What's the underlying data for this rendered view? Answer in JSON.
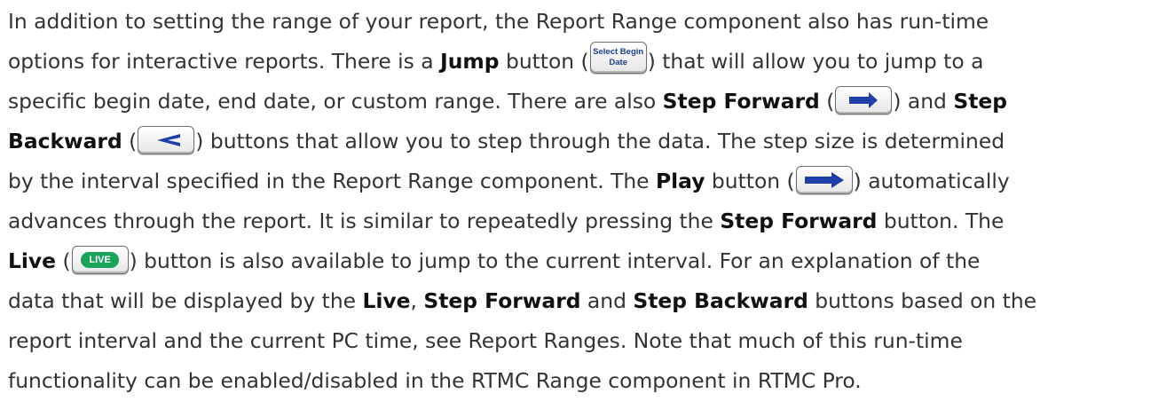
{
  "text": {
    "l1": "In addition to setting the range of your report, the Report Range component also has run-time",
    "l2a": "options for interactive reports. There is a ",
    "jump_term": "Jump",
    "l2b": " button (",
    "l2c": ") that will allow you to jump to a",
    "l3a": "specific begin date, end date, or custom range. There are also ",
    "step_forward_term": "Step Forward",
    "l3b": " (",
    "l3c": ") and ",
    "step_term": "Step",
    "backward_term": "Backward",
    "l4a": " (",
    "l4b": ") buttons that allow you to step through the data. The step size is determined",
    "l5a": "by the interval specified in the Report Range component. The ",
    "play_term": "Play",
    "l5b": " button (",
    "l5c": ") automatically",
    "l6a": "advances through the report. It is similar to repeatedly pressing the ",
    "step_forward_term2": "Step Forward",
    "l6b": " button. The",
    "live_term": "Live",
    "l7a": " (",
    "l7b": ") button is also available to jump to the current interval. For an explanation of the",
    "l8a": "data that will be displayed by the ",
    "live_term2": "Live",
    "l8b": ", ",
    "step_forward_term3": "Step Forward",
    "l8c": " and ",
    "step_backward_term": "Step Backward",
    "l8d": " buttons based on the",
    "l9": "report interval and the current PC time, see Report Ranges. Note that much of this run-time",
    "l10": "functionality can be enabled/disabled in the RTMC Range component in RTMC Pro."
  },
  "buttons": {
    "jump_line1": "Select Begin",
    "jump_line2": "Date",
    "live_label": "LIVE"
  },
  "colors": {
    "arrow_blue": "#1e3fa8",
    "live_green": "#1aa35a"
  },
  "icons": {
    "step_forward": "chevron-right-icon",
    "step_backward": "chevron-left-icon",
    "play": "play-triangle-icon"
  }
}
